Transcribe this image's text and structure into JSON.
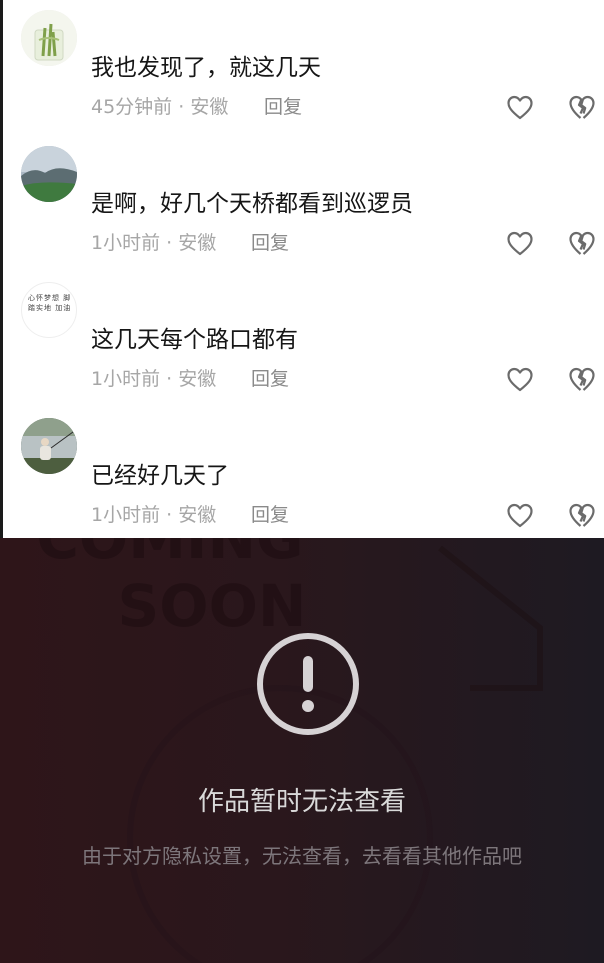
{
  "comments": [
    {
      "text": "我也发现了，就这几天",
      "time": "45分钟前",
      "location": "安徽",
      "reply_label": "回复"
    },
    {
      "text": "是啊，好几个天桥都看到巡逻员",
      "time": "1小时前",
      "location": "安徽",
      "reply_label": "回复"
    },
    {
      "text": "这几天每个路口都有",
      "time": "1小时前",
      "location": "安徽",
      "reply_label": "回复",
      "avatar_text": "心怀梦想 脚踏实地 加油"
    },
    {
      "text": "已经好几天了",
      "time": "1小时前",
      "location": "安徽",
      "reply_label": "回复"
    }
  ],
  "meta_separator": " · ",
  "unavailable": {
    "title": "作品暂时无法查看",
    "subtitle": "由于对方隐私设置，无法查看，去看看其他作品吧",
    "watermark_line1": "COMING",
    "watermark_line2": "SOON"
  },
  "colors": {
    "comment_text": "#161616",
    "meta_text": "#a6a6a6",
    "panel_bg": "#2a171c",
    "panel_title": "#d9d9d9",
    "panel_subtitle": "#7d767b"
  },
  "icons": {
    "like": "heart-outline-icon",
    "dislike": "broken-heart-icon",
    "warning": "exclamation-circle-icon"
  }
}
